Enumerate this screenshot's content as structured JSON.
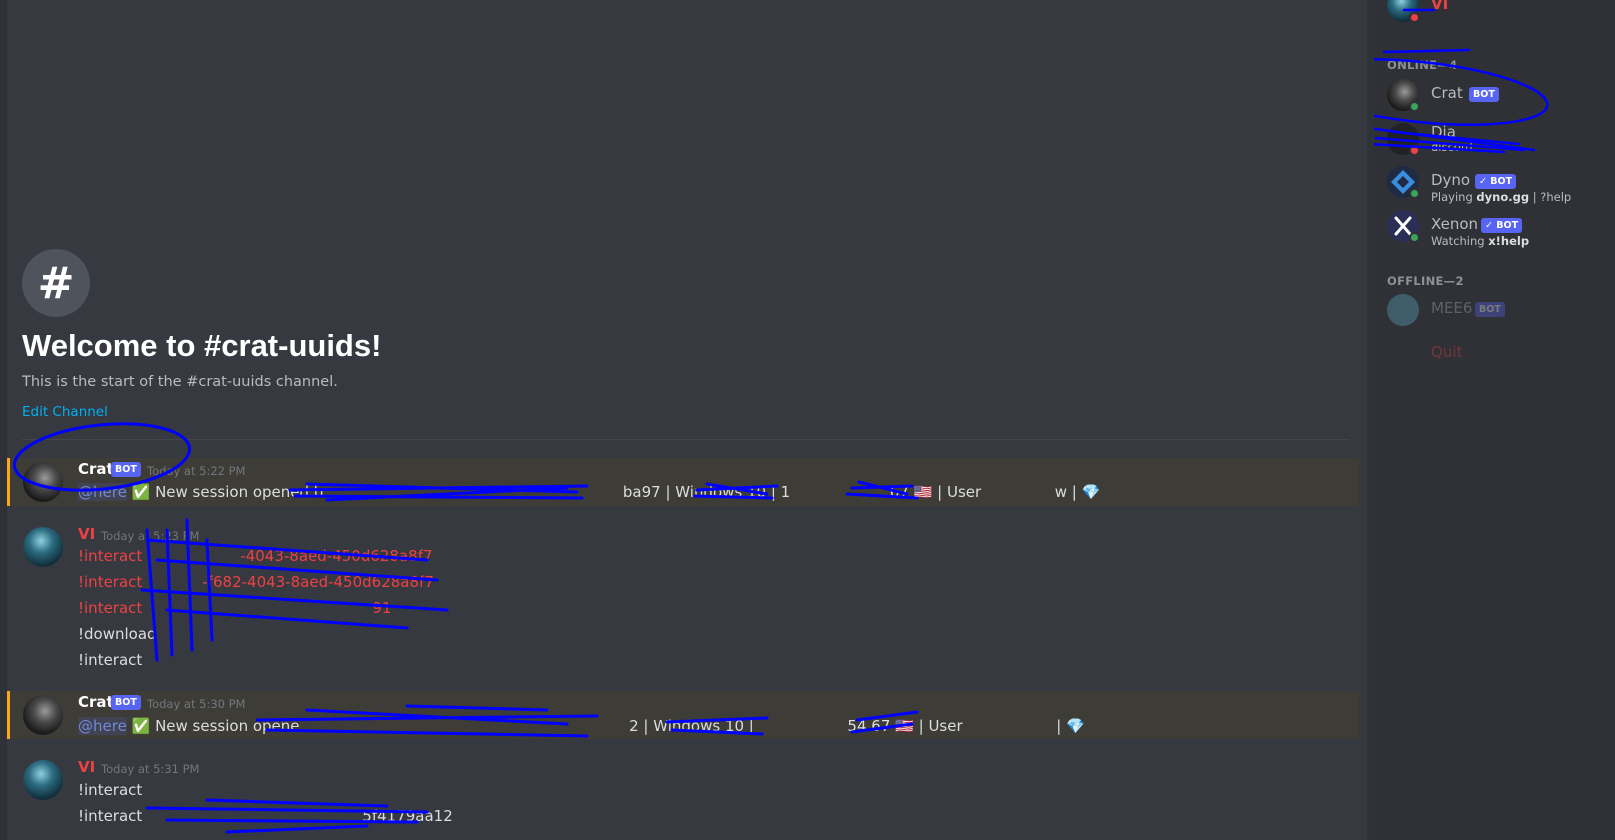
{
  "welcome": {
    "hash_icon": "#",
    "title": "Welcome to #crat-uuids!",
    "subtitle": "This is the start of the #crat-uuids channel.",
    "edit_link": "Edit Channel"
  },
  "messages": [
    {
      "author": "Crat",
      "bot_tag": "BOT",
      "timestamp": "Today at 5:22 PM",
      "mention": "@here",
      "check_emoji": "✅",
      "text_a": "New session opened b",
      "text_b": "ba97 | Windows 10 | 1",
      "text_c": "67",
      "flag_emoji": "🇺🇸",
      "text_d": "| User",
      "text_e": "w |",
      "gem_emoji": "💎"
    },
    {
      "author": "VI",
      "timestamp": "Today at 5:23 PM",
      "lines": [
        "!interact",
        "!interact",
        "!interact",
        "!download",
        "!interact"
      ],
      "line_tails": [
        "-4043-8aed-450d628a8f7",
        "-f682-4043-8aed-450d628a8f7",
        "91"
      ]
    },
    {
      "author": "Crat",
      "bot_tag": "BOT",
      "timestamp": "Today at 5:30 PM",
      "mention": "@here",
      "check_emoji": "✅",
      "text_a": "New session opene",
      "text_b": "2 | Windows 10 |",
      "text_c": "54.67",
      "flag_emoji": "🇺🇸",
      "text_d": "| User",
      "text_e": "|",
      "gem_emoji": "💎"
    },
    {
      "author": "VI",
      "timestamp": "Today at 5:31 PM",
      "lines": [
        "!interact",
        "!interact"
      ],
      "line_tails": [
        "",
        "5f4179aa12"
      ]
    }
  ],
  "members": {
    "top_member": "VI",
    "online_header": "ONLINE—4",
    "offline_header": "OFFLINE—2",
    "online": [
      {
        "name": "Crat",
        "bot": "BOT",
        "activity": ""
      },
      {
        "name": "Dia",
        "bot": "",
        "activity": "discord"
      },
      {
        "name": "Dyno",
        "bot": "✓ BOT",
        "activity_prefix": "Playing ",
        "activity_bold": "dyno.gg",
        "activity_suffix": " | ?help"
      },
      {
        "name": "Xenon",
        "bot": "✓ BOT",
        "activity_prefix": "Watching ",
        "activity_bold": "x!help",
        "activity_suffix": ""
      }
    ],
    "offline": [
      {
        "name": "MEE6",
        "bot": "BOT"
      },
      {
        "name": "Quit",
        "bot": ""
      }
    ]
  },
  "colors": {
    "background": "#36393f",
    "sidebar": "#2f3136",
    "mention_highlight": "#faa61a",
    "bot_tag": "#5865f2",
    "link": "#00b0f4",
    "vi_role": "#ed4245",
    "scribble": "#0000ff"
  }
}
